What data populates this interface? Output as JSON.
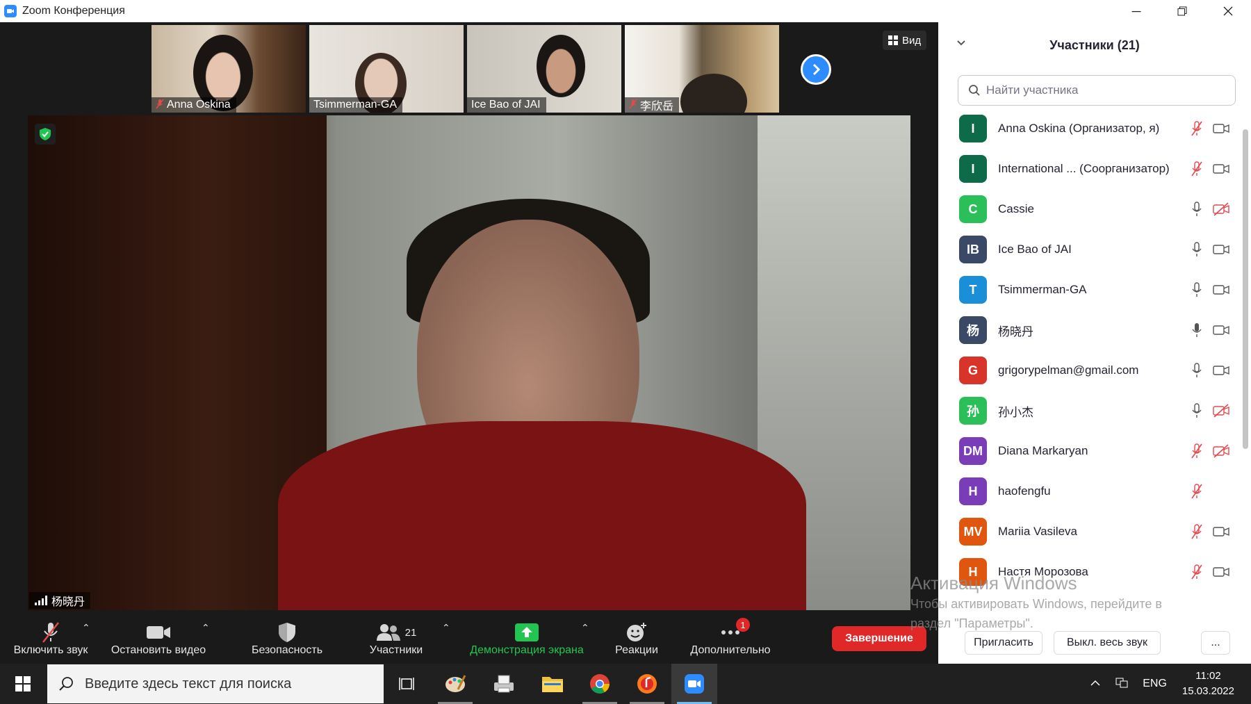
{
  "window": {
    "title": "Zoom Конференция"
  },
  "video": {
    "view_label": "Вид",
    "thumbnails": [
      {
        "name": "Anna Oskina",
        "muted": true
      },
      {
        "name": "Tsimmerman-GA",
        "muted": false
      },
      {
        "name": "Ice Bao of JAI",
        "muted": false
      },
      {
        "name": "李欣岳",
        "muted": true
      }
    ],
    "active_speaker": "杨晓丹"
  },
  "toolbar": {
    "unmute_label": "Включить звук",
    "stop_video_label": "Остановить видео",
    "security_label": "Безопасность",
    "participants_label": "Участники",
    "participants_count": "21",
    "share_label": "Демонстрация экрана",
    "reactions_label": "Реакции",
    "more_label": "Дополнительно",
    "more_badge": "1",
    "end_label": "Завершение"
  },
  "panel": {
    "title": "Участники (21)",
    "search_placeholder": "Найти участника",
    "participants": [
      {
        "initials": "I",
        "name": "Anna Oskina (Организатор, я)",
        "color": "#0e6b4a",
        "mic": "muted",
        "cam": "on"
      },
      {
        "initials": "I",
        "name": "International ... (Соорганизатор)",
        "color": "#0e6b4a",
        "mic": "muted",
        "cam": "on"
      },
      {
        "initials": "C",
        "name": "Cassie",
        "color": "#2bbf5a",
        "mic": "on",
        "cam": "off"
      },
      {
        "initials": "IB",
        "name": "Ice Bao of JAI",
        "color": "#3a4a66",
        "mic": "on",
        "cam": "on"
      },
      {
        "initials": "T",
        "name": "Tsimmerman-GA",
        "color": "#1a8fd8",
        "mic": "on",
        "cam": "on"
      },
      {
        "initials": "杨",
        "name": "杨晓丹",
        "color": "#3a4a66",
        "mic": "speaking",
        "cam": "on"
      },
      {
        "initials": "G",
        "name": "grigorypelman@gmail.com",
        "color": "#d8342a",
        "mic": "on",
        "cam": "on"
      },
      {
        "initials": "孙",
        "name": "孙小杰",
        "color": "#2bbf5a",
        "mic": "on",
        "cam": "off"
      },
      {
        "initials": "DM",
        "name": "Diana Markaryan",
        "color": "#7a3db8",
        "mic": "muted",
        "cam": "off"
      },
      {
        "initials": "H",
        "name": "haofengfu",
        "color": "#7a3db8",
        "mic": "muted",
        "cam": "none"
      },
      {
        "initials": "MV",
        "name": "Mariia Vasileva",
        "color": "#e0560e",
        "mic": "muted",
        "cam": "on"
      },
      {
        "initials": "Н",
        "name": "Настя Морозова",
        "color": "#e0560e",
        "mic": "muted",
        "cam": "on"
      }
    ],
    "invite_label": "Пригласить",
    "mute_all_label": "Выкл. весь звук",
    "more_label": "..."
  },
  "activation": {
    "title": "Активация Windows",
    "text": "Чтобы активировать Windows, перейдите в раздел \"Параметры\"."
  },
  "taskbar": {
    "search_placeholder": "Введите здесь текст для поиска",
    "lang": "ENG",
    "time": "11:02",
    "date": "15.03.2022"
  }
}
